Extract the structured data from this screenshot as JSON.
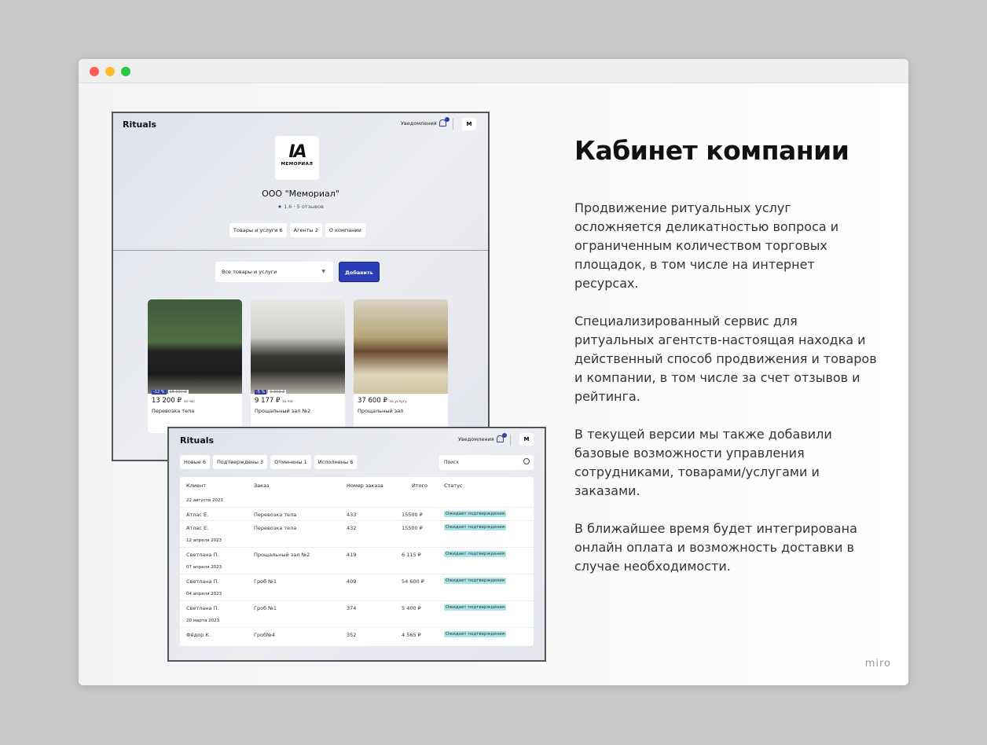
{
  "window": {
    "controls": [
      "close",
      "minimize",
      "maximize"
    ],
    "colors": {
      "close": "#ff5f57",
      "minimize": "#febc2e",
      "maximize": "#28c840"
    }
  },
  "profile": {
    "brand": "Rituals",
    "notifications": "Уведомления",
    "company": "ООО \"Мемориал\"",
    "logo_text": "МЕМОРИАЛ",
    "rating": "1.6 · 5 отзывов",
    "tabs": [
      "Товары и услуги 6",
      "Агенты 2",
      "О компании"
    ],
    "filter": "Все товары и услуги",
    "add_button": "Добавить",
    "cards": [
      {
        "discount": "-12 %",
        "old_price": "15 000 ₽",
        "price": "13 200 ₽",
        "unit": "за час",
        "title": "Перевозка тела"
      },
      {
        "discount": "-5 %",
        "old_price": "9 660 ₽",
        "price": "9 177 ₽",
        "unit": "за час",
        "title": "Прощальный зал №2"
      },
      {
        "price": "37 600 ₽",
        "unit": "за услугу",
        "title": "Прощальный зал"
      }
    ]
  },
  "orders": {
    "brand": "Rituals",
    "notifications": "Уведомления",
    "tabs": [
      "Новые 6",
      "Подтверждены 3",
      "Отменены 1",
      "Исполнены 6"
    ],
    "search_placeholder": "Поиск",
    "columns": [
      "Клиент",
      "Заказ",
      "Номер заказа",
      "Итого",
      "Статус"
    ],
    "rows": [
      {
        "date": "22 августа 2023"
      },
      {
        "client": "Атлас Е.",
        "order": "Перевозка тела",
        "num": "433",
        "total": "15500 ₽",
        "status": "Ожидает подтверждения"
      },
      {
        "client": "Атлас Е.",
        "order": "Перевозка тела",
        "num": "432",
        "total": "15500 ₽",
        "status": "Ожидает подтверждения"
      },
      {
        "date": "12 апреля 2023"
      },
      {
        "client": "Светлана П.",
        "order": "Прощальный зал №2",
        "num": "419",
        "total": "6 115 ₽",
        "status": "Ожидает подтверждения"
      },
      {
        "date": "07 апреля 2023"
      },
      {
        "client": "Светлана П.",
        "order": "Гроб №1",
        "num": "409",
        "total": "54 600 ₽",
        "status": "Ожидает подтверждения"
      },
      {
        "date": "04 апреля 2023"
      },
      {
        "client": "Светлана П.",
        "order": "Гроб №1",
        "num": "374",
        "total": "5 400 ₽",
        "status": "Ожидает подтверждения"
      },
      {
        "date": "20 марта 2023"
      },
      {
        "client": "Фёдор К.",
        "order": "Гроб№4",
        "num": "352",
        "total": "4 565 ₽",
        "status": "Ожидает подтверждения"
      }
    ]
  },
  "text": {
    "title": "Кабинет компании",
    "paragraphs": [
      "Продвижение ритуальных услуг осложняется деликатностью вопроса и ограниченным количеством торговых площадок, в том числе на интернет ресурсах.",
      "Специализированный сервис для ритуальных агентств-настоящая находка и действенный способ продвижения и товаров и компании, в том числе за счет отзывов и рейтинга.",
      "В текущей версии мы также добавили базовые возможности управления сотрудниками, товарами/услугами и заказами.",
      "В ближайшее время будет интегрирована онлайн оплата и возможность доставки в случае необходимости."
    ]
  },
  "watermark": "miro"
}
